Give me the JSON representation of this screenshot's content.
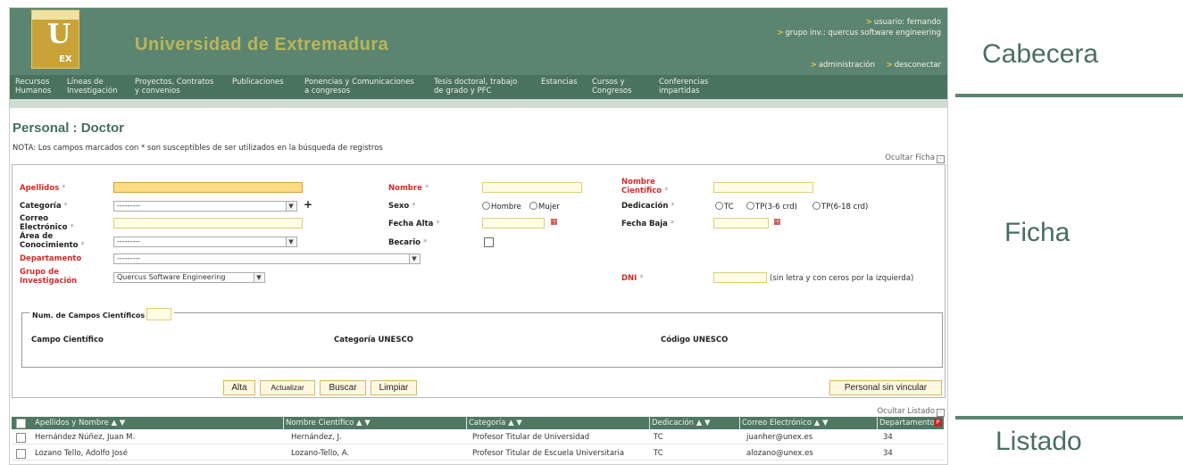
{
  "header": {
    "logo_text": "U",
    "logo_sub": "EX",
    "university": "Universidad de  Extremadura",
    "user_line": "usuario: fernando",
    "group_line": "grupo inv.: quercus software engineering",
    "admin_link": "administración",
    "logout_link": "desconectar"
  },
  "nav": [
    "Recursos\nHumanos",
    "Líneas de\nInvestigación",
    "Proyectos, Contratos\ny convenios",
    "Publicaciones",
    "Ponencias y Comunicaciones\na congresos",
    "Tesis doctoral, trabajo\nde grado y PFC",
    "Estancias",
    "Cursos y\nCongresos",
    "Conferencias\nimpartidas"
  ],
  "page": {
    "title": "Personal : Doctor",
    "note": "NOTA: Los campos marcados con * son susceptibles de ser utilizados en la búsqueda de registros",
    "hide_ficha": "Ocultar Ficha",
    "hide_listado": "Ocultar Listado"
  },
  "form": {
    "apellidos_label": "Apellidos",
    "nombre_label": "Nombre",
    "nombre_cientifico_label": "Nombre\nCientífico",
    "categoria_label": "Categoría",
    "categoria_value": "---------",
    "sexo_label": "Sexo",
    "sexo_hombre": "Hombre",
    "sexo_mujer": "Mujer",
    "dedicacion_label": "Dedicación",
    "dedicacion_tc": "TC",
    "dedicacion_tp36": "TP(3-6 crd)",
    "dedicacion_tp618": "TP(6-18 crd)",
    "correo_label": "Correo\nElectrónico",
    "fecha_alta_label": "Fecha Alta",
    "fecha_baja_label": "Fecha Baja",
    "area_label": "Área de\nConocimiento",
    "area_value": "---------",
    "becario_label": "Becario",
    "departamento_label": "Departamento",
    "departamento_value": "---------",
    "grupo_label": "Grupo de\nInvestigación",
    "grupo_value": "Quercus Software Engineering",
    "dni_label": "DNI",
    "dni_hint": "(sin letra y con ceros por la izquierda)",
    "required_mark": "*",
    "campos_legend": "Num. de Campos Científicos",
    "col_campo": "Campo Científico",
    "col_categoria_unesco": "Categoría UNESCO",
    "col_codigo_unesco": "Código UNESCO"
  },
  "buttons": {
    "alta": "Alta",
    "actualizar": "Actualizar",
    "buscar": "Buscar",
    "limpiar": "Limpiar",
    "sin_vincular": "Personal sin vincular"
  },
  "table": {
    "headers": [
      "Apellidos y Nombre ▲ ▼",
      "Nombre Científico ▲ ▼",
      "Categoría ▲ ▼",
      "Dedicación ▲ ▼",
      "Correo Electrónico ▲ ▼",
      "Departamento"
    ],
    "rows": [
      [
        "Hernández Núñez, Juan M.",
        "Hernández, J.",
        "Profesor Titular de Universidad",
        "TC",
        "juanher@unex.es",
        "34"
      ],
      [
        "Lozano Tello, Adolfo José",
        "Lozano-Tello, A.",
        "Profesor Titular de Escuela Universitaria",
        "TC",
        "alozano@unex.es",
        "34"
      ]
    ]
  },
  "annotations": {
    "cabecera": "Cabecera",
    "ficha": "Ficha",
    "listado": "Listado"
  },
  "colors": {
    "header_green": "#5c8571",
    "required_red": "#d42b2b",
    "input_yellow": "#fffde8"
  }
}
